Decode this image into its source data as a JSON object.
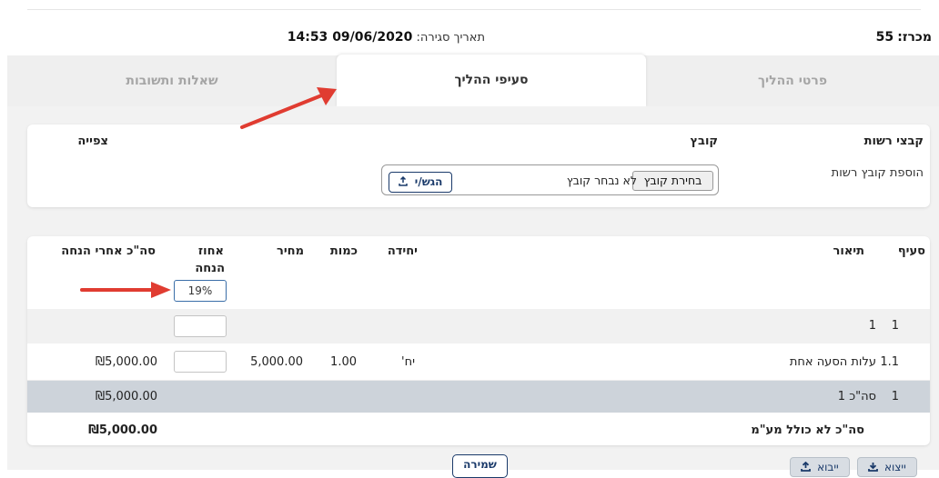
{
  "header": {
    "tender_label": "מכרז:",
    "tender_number": "55",
    "closing_label": "תאריך סגירה:",
    "closing_value": "09/06/2020 14:53"
  },
  "tabs": [
    {
      "label": "פרטי ההליך",
      "active": false
    },
    {
      "label": "סעיפי ההליך",
      "active": true
    },
    {
      "label": "שאלות ותשובות",
      "active": false
    }
  ],
  "files": {
    "col_optional": "קבצי רשות",
    "col_file": "קובץ",
    "col_view": "צפייה",
    "row_label": "הוספת קובץ רשות",
    "choose_button": "בחירת קובץ",
    "no_file_text": "לא נבחר קובץ",
    "submit_button": "הגש/י"
  },
  "items_table": {
    "headers": {
      "section": "סעיף",
      "description": "תיאור",
      "unit": "יחידה",
      "quantity": "כמות",
      "price": "מחיר",
      "discount_line1": "אחוז",
      "discount_line2": "הנחה",
      "total_after_discount": "סה\"כ אחרי הנחה"
    },
    "global_discount_value": "19%",
    "rows": [
      {
        "section": "1",
        "description": "1",
        "unit": "",
        "quantity": "",
        "price": "",
        "total": ""
      },
      {
        "section": "1.1",
        "description": "עלות הסעה אחת",
        "unit": "יח'",
        "quantity": "1.00",
        "price": "5,000.00",
        "total": "₪5,000.00"
      },
      {
        "section": "1",
        "description": "סה\"כ 1",
        "unit": "",
        "quantity": "",
        "price": "",
        "total": "₪5,000.00"
      }
    ],
    "grand_total_label": "סה\"כ לא כולל מע\"מ",
    "grand_total_value": "₪5,000.00"
  },
  "actions": {
    "save": "שמירה",
    "import": "ייבוא",
    "export": "ייצוא"
  },
  "colors": {
    "primary": "#1a3a6a",
    "annotation_arrow": "#e03c31",
    "total_row_bg": "#cdd3da"
  }
}
